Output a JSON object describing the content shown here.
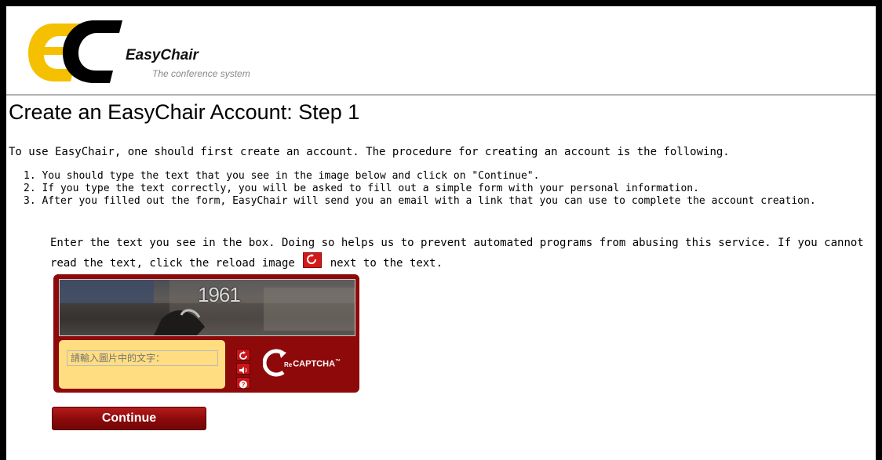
{
  "brand": {
    "name": "EasyChair",
    "tagline": "The conference system",
    "logo_letters": "EC",
    "logo_colors": {
      "primary": "#f5c000",
      "secondary": "#000000"
    }
  },
  "page": {
    "title": "Create an EasyChair Account: Step 1",
    "intro": "To use EasyChair, one should first create an account. The procedure for creating an account is the following.",
    "steps": [
      "1. You should type the text that you see in the image below and click on \"Continue\".",
      "2. If you type the text correctly, you will be asked to fill out a simple form with your personal information.",
      "3. After you filled out the form, EasyChair will send you an email with a link that you can use to complete the account creation."
    ],
    "captcha_help_before": "Enter the text you see in the box. Doing so helps us to prevent automated programs from abusing this service. If you cannot read the text, click the reload image",
    "captcha_help_after": "next to the text."
  },
  "captcha": {
    "image_text": "1961",
    "input_placeholder": "請輸入圖片中的文字：",
    "buttons": [
      "reload-icon",
      "audio-icon",
      "help-icon"
    ],
    "brand_re": "Re",
    "brand_name": "CAPTCHA",
    "brand_tm": "™",
    "colors": {
      "frame": "#8e0a0a",
      "input_bg": "#ffdd80",
      "button": "#c9161a"
    }
  },
  "actions": {
    "continue_label": "Continue"
  }
}
